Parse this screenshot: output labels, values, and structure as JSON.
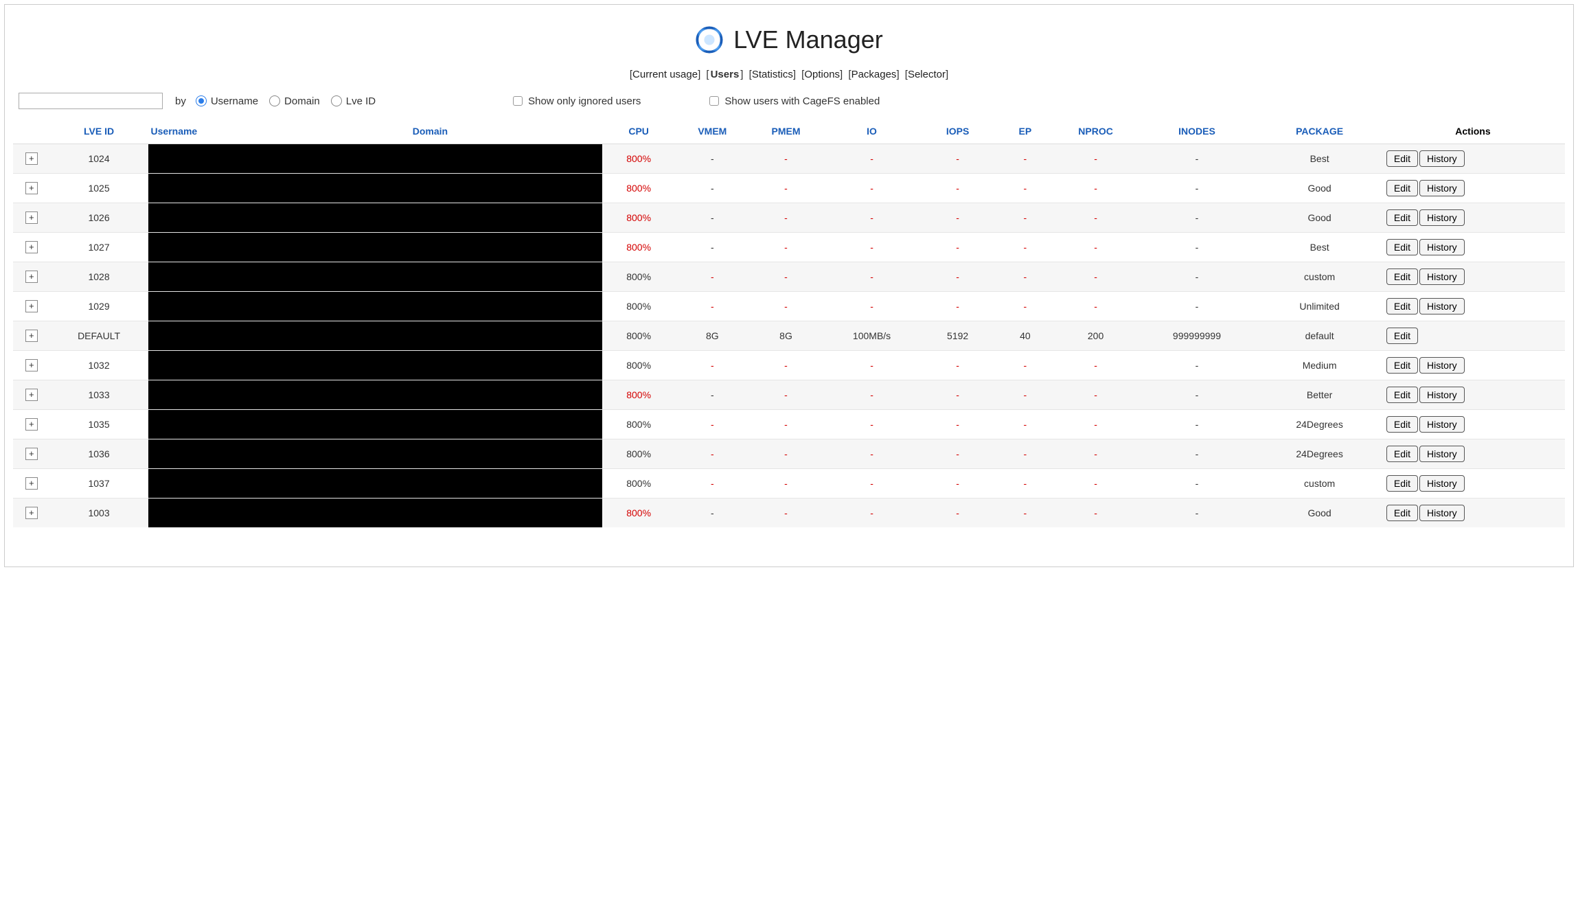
{
  "header": {
    "title": "LVE Manager"
  },
  "nav": {
    "items": [
      "Current usage",
      "Users",
      "Statistics",
      "Options",
      "Packages",
      "Selector"
    ],
    "active": "Users"
  },
  "filters": {
    "by_label": "by",
    "radio_options": {
      "username": "Username",
      "domain": "Domain",
      "lve_id": "Lve ID"
    },
    "radio_selected": "username",
    "show_ignored_label": "Show only ignored users",
    "show_cagefs_label": "Show users with CageFS enabled"
  },
  "table": {
    "headers": {
      "lve_id": "LVE ID",
      "username": "Username",
      "domain": "Domain",
      "cpu": "CPU",
      "vmem": "VMEM",
      "pmem": "PMEM",
      "io": "IO",
      "iops": "IOPS",
      "ep": "EP",
      "nproc": "NPROC",
      "inodes": "INODES",
      "package": "PACKAGE",
      "actions": "Actions"
    },
    "buttons": {
      "edit": "Edit",
      "history": "History"
    },
    "rows": [
      {
        "lve_id": "1024",
        "cpu": "800%",
        "cpu_red": true,
        "vmem": "-",
        "vmem_red": false,
        "pmem": "-",
        "pmem_red": true,
        "io": "-",
        "io_red": true,
        "iops": "-",
        "iops_red": true,
        "ep": "-",
        "ep_red": true,
        "nproc": "-",
        "nproc_red": true,
        "inodes": "-",
        "package": "Best",
        "history": true,
        "striped": true
      },
      {
        "lve_id": "1025",
        "cpu": "800%",
        "cpu_red": true,
        "vmem": "-",
        "vmem_red": false,
        "pmem": "-",
        "pmem_red": true,
        "io": "-",
        "io_red": true,
        "iops": "-",
        "iops_red": true,
        "ep": "-",
        "ep_red": true,
        "nproc": "-",
        "nproc_red": true,
        "inodes": "-",
        "package": "Good",
        "history": true,
        "striped": false
      },
      {
        "lve_id": "1026",
        "cpu": "800%",
        "cpu_red": true,
        "vmem": "-",
        "vmem_red": false,
        "pmem": "-",
        "pmem_red": true,
        "io": "-",
        "io_red": true,
        "iops": "-",
        "iops_red": true,
        "ep": "-",
        "ep_red": true,
        "nproc": "-",
        "nproc_red": true,
        "inodes": "-",
        "package": "Good",
        "history": true,
        "striped": true
      },
      {
        "lve_id": "1027",
        "cpu": "800%",
        "cpu_red": true,
        "vmem": "-",
        "vmem_red": false,
        "pmem": "-",
        "pmem_red": true,
        "io": "-",
        "io_red": true,
        "iops": "-",
        "iops_red": true,
        "ep": "-",
        "ep_red": true,
        "nproc": "-",
        "nproc_red": true,
        "inodes": "-",
        "package": "Best",
        "history": true,
        "striped": false
      },
      {
        "lve_id": "1028",
        "cpu": "800%",
        "cpu_red": false,
        "vmem": "-",
        "vmem_red": true,
        "pmem": "-",
        "pmem_red": true,
        "io": "-",
        "io_red": true,
        "iops": "-",
        "iops_red": true,
        "ep": "-",
        "ep_red": true,
        "nproc": "-",
        "nproc_red": true,
        "inodes": "-",
        "package": "custom",
        "history": true,
        "striped": true
      },
      {
        "lve_id": "1029",
        "cpu": "800%",
        "cpu_red": false,
        "vmem": "-",
        "vmem_red": true,
        "pmem": "-",
        "pmem_red": true,
        "io": "-",
        "io_red": true,
        "iops": "-",
        "iops_red": true,
        "ep": "-",
        "ep_red": true,
        "nproc": "-",
        "nproc_red": true,
        "inodes": "-",
        "package": "Unlimited",
        "history": true,
        "striped": false
      },
      {
        "lve_id": "DEFAULT",
        "cpu": "800%",
        "cpu_red": false,
        "vmem": "8G",
        "vmem_red": false,
        "pmem": "8G",
        "pmem_red": false,
        "io": "100MB/s",
        "io_red": false,
        "iops": "5192",
        "iops_red": false,
        "ep": "40",
        "ep_red": false,
        "nproc": "200",
        "nproc_red": false,
        "inodes": "999999999",
        "package": "default",
        "history": false,
        "striped": true
      },
      {
        "lve_id": "1032",
        "cpu": "800%",
        "cpu_red": false,
        "vmem": "-",
        "vmem_red": true,
        "pmem": "-",
        "pmem_red": true,
        "io": "-",
        "io_red": true,
        "iops": "-",
        "iops_red": true,
        "ep": "-",
        "ep_red": true,
        "nproc": "-",
        "nproc_red": true,
        "inodes": "-",
        "package": "Medium",
        "history": true,
        "striped": false
      },
      {
        "lve_id": "1033",
        "cpu": "800%",
        "cpu_red": true,
        "vmem": "-",
        "vmem_red": false,
        "pmem": "-",
        "pmem_red": true,
        "io": "-",
        "io_red": true,
        "iops": "-",
        "iops_red": true,
        "ep": "-",
        "ep_red": true,
        "nproc": "-",
        "nproc_red": true,
        "inodes": "-",
        "package": "Better",
        "history": true,
        "striped": true
      },
      {
        "lve_id": "1035",
        "cpu": "800%",
        "cpu_red": false,
        "vmem": "-",
        "vmem_red": true,
        "pmem": "-",
        "pmem_red": true,
        "io": "-",
        "io_red": true,
        "iops": "-",
        "iops_red": true,
        "ep": "-",
        "ep_red": true,
        "nproc": "-",
        "nproc_red": true,
        "inodes": "-",
        "package": "24Degrees",
        "history": true,
        "striped": false
      },
      {
        "lve_id": "1036",
        "cpu": "800%",
        "cpu_red": false,
        "vmem": "-",
        "vmem_red": true,
        "pmem": "-",
        "pmem_red": true,
        "io": "-",
        "io_red": true,
        "iops": "-",
        "iops_red": true,
        "ep": "-",
        "ep_red": true,
        "nproc": "-",
        "nproc_red": true,
        "inodes": "-",
        "package": "24Degrees",
        "history": true,
        "striped": true
      },
      {
        "lve_id": "1037",
        "cpu": "800%",
        "cpu_red": false,
        "vmem": "-",
        "vmem_red": true,
        "pmem": "-",
        "pmem_red": true,
        "io": "-",
        "io_red": true,
        "iops": "-",
        "iops_red": true,
        "ep": "-",
        "ep_red": true,
        "nproc": "-",
        "nproc_red": true,
        "inodes": "-",
        "package": "custom",
        "history": true,
        "striped": false
      },
      {
        "lve_id": "1003",
        "cpu": "800%",
        "cpu_red": true,
        "vmem": "-",
        "vmem_red": false,
        "pmem": "-",
        "pmem_red": true,
        "io": "-",
        "io_red": true,
        "iops": "-",
        "iops_red": true,
        "ep": "-",
        "ep_red": true,
        "nproc": "-",
        "nproc_red": true,
        "inodes": "-",
        "package": "Good",
        "history": true,
        "striped": true
      }
    ]
  }
}
